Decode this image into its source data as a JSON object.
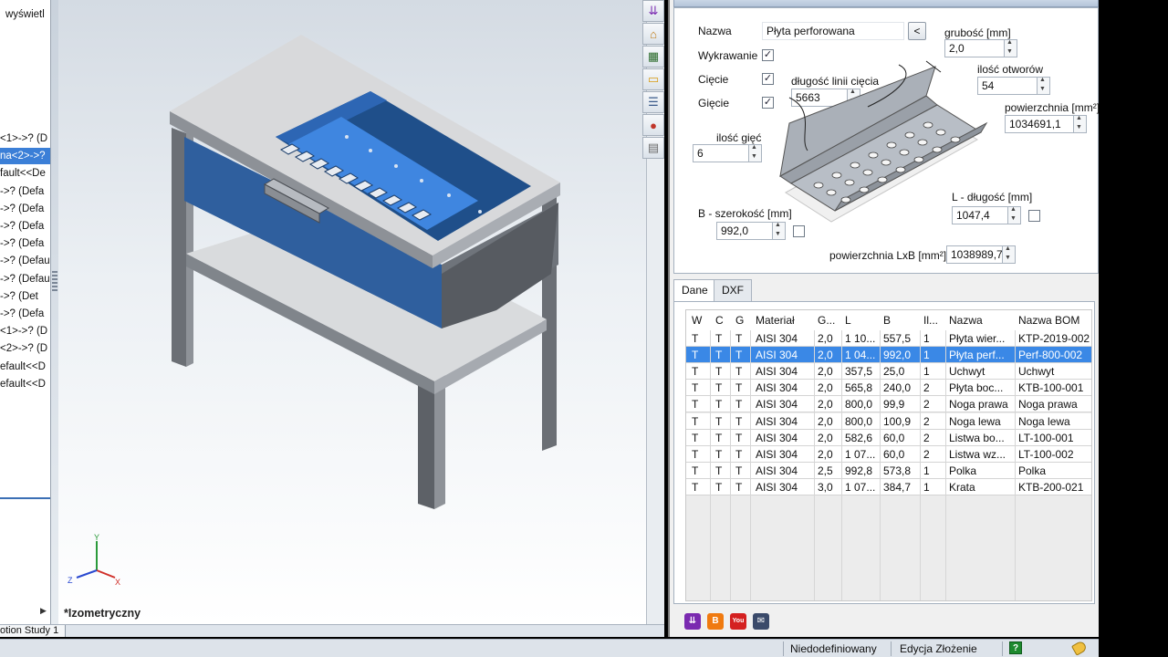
{
  "tree": {
    "title": "wyświetl",
    "items": [
      {
        "label": "<1>->? (D",
        "selected": false
      },
      {
        "label": "na<2>->?",
        "selected": true
      },
      {
        "label": "fault<<De",
        "selected": false
      },
      {
        "label": "->? (Defa",
        "selected": false
      },
      {
        "label": "->? (Defa",
        "selected": false
      },
      {
        "label": "->? (Defa",
        "selected": false
      },
      {
        "label": "->? (Defa",
        "selected": false
      },
      {
        "label": "->? (Defaul",
        "selected": false
      },
      {
        "label": "->? (Defaul",
        "selected": false
      },
      {
        "label": "->? (Det",
        "selected": false
      },
      {
        "label": "->? (Defa",
        "selected": false
      },
      {
        "label": "<1>->? (D",
        "selected": false
      },
      {
        "label": "<2>->? (D",
        "selected": false
      },
      {
        "label": "efault<<D",
        "selected": false
      },
      {
        "label": "efault<<D",
        "selected": false
      }
    ]
  },
  "viewport": {
    "view_name": "*Izometryczny",
    "triad": {
      "x": "X",
      "y": "Y",
      "z": "Z"
    }
  },
  "bottom_tab": {
    "label": "otion Study 1"
  },
  "status": {
    "state": "Niedodefiniowany",
    "mode": "Edycja Złożenie",
    "help": "?"
  },
  "side_icons": [
    {
      "name": "chevrons-down-icon",
      "glyph": "⇊",
      "color": "#7a2ab0"
    },
    {
      "name": "home-icon",
      "glyph": "⌂",
      "color": "#c07a10"
    },
    {
      "name": "parts-icon",
      "glyph": "▦",
      "color": "#2a6a2a"
    },
    {
      "name": "folder-icon",
      "glyph": "▭",
      "color": "#d89a10"
    },
    {
      "name": "list-icon",
      "glyph": "☰",
      "color": "#3a5a8a"
    },
    {
      "name": "appearance-icon",
      "glyph": "●",
      "color": "#c0352a"
    },
    {
      "name": "custom-props-icon",
      "glyph": "▤",
      "color": "#6a6a6a"
    }
  ],
  "form": {
    "name_label": "Nazwa",
    "name_value": "Płyta perforowana",
    "back_button": "<",
    "wykrawanie_label": "Wykrawanie",
    "wykrawanie_checked": true,
    "ciecie_label": "Cięcie",
    "ciecie_checked": true,
    "giecie_label": "Gięcie",
    "giecie_checked": true,
    "grubosc_label": "grubość [mm]",
    "grubosc_value": "2,0",
    "ilosc_otworow_label": "ilość otworów",
    "ilosc_otworow_value": "54",
    "dlugosc_linii_label": "długość linii cięcia",
    "dlugosc_linii_value": "5663",
    "powierzchnia_label": "powierzchnia [mm²]",
    "powierzchnia_value": "1034691,1",
    "ilosc_giec_label": "ilość gięć",
    "ilosc_giec_value": "6",
    "szerokosc_label": "B - szerokość [mm]",
    "szerokosc_value": "992,0",
    "dlugosc_label": "L - długość [mm]",
    "dlugosc_value": "1047,4",
    "powierzchnia_lxb_label": "powierzchnia LxB [mm²]",
    "powierzchnia_lxb_value": "1038989,7"
  },
  "tabs": [
    {
      "label": "Dane",
      "active": true
    },
    {
      "label": "DXF",
      "active": false
    }
  ],
  "table": {
    "columns": [
      "W",
      "C",
      "G",
      "Materiał",
      "G...",
      "L",
      "B",
      "Il...",
      "Nazwa",
      "Nazwa BOM"
    ],
    "rows": [
      {
        "selected": false,
        "cells": [
          "T",
          "T",
          "T",
          "AISI 304",
          "2,0",
          "1 10...",
          "557,5",
          "1",
          "Płyta wier...",
          "KTP-2019-002"
        ]
      },
      {
        "selected": true,
        "cells": [
          "T",
          "T",
          "T",
          "AISI 304",
          "2,0",
          "1 04...",
          "992,0",
          "1",
          "Płyta perf...",
          "Perf-800-002"
        ]
      },
      {
        "selected": false,
        "cells": [
          "T",
          "T",
          "T",
          "AISI 304",
          "2,0",
          "357,5",
          "25,0",
          "1",
          "Uchwyt",
          "Uchwyt"
        ]
      },
      {
        "selected": false,
        "cells": [
          "T",
          "T",
          "T",
          "AISI 304",
          "2,0",
          "565,8",
          "240,0",
          "2",
          "Płyta boc...",
          "KTB-100-001"
        ]
      },
      {
        "selected": false,
        "cells": [
          "T",
          "T",
          "T",
          "AISI 304",
          "2,0",
          "800,0",
          "99,9",
          "2",
          "Noga prawa",
          "Noga prawa"
        ]
      },
      {
        "selected": false,
        "cells": [
          "T",
          "T",
          "T",
          "AISI 304",
          "2,0",
          "800,0",
          "100,9",
          "2",
          "Noga lewa",
          "Noga lewa"
        ]
      },
      {
        "selected": false,
        "cells": [
          "T",
          "T",
          "T",
          "AISI 304",
          "2,0",
          "582,6",
          "60,0",
          "2",
          "Listwa bo...",
          "LT-100-001"
        ]
      },
      {
        "selected": false,
        "cells": [
          "T",
          "T",
          "T",
          "AISI 304",
          "2,0",
          "1 07...",
          "60,0",
          "2",
          "Listwa wz...",
          "LT-100-002"
        ]
      },
      {
        "selected": false,
        "cells": [
          "T",
          "T",
          "T",
          "AISI 304",
          "2,5",
          "992,8",
          "573,8",
          "1",
          "Polka",
          "Polka"
        ]
      },
      {
        "selected": false,
        "cells": [
          "T",
          "T",
          "T",
          "AISI 304",
          "3,0",
          "1 07...",
          "384,7",
          "1",
          "Krata",
          "KTB-200-021"
        ]
      }
    ]
  },
  "toolbar": [
    {
      "name": "chevrons-down-icon",
      "glyph": "⇊",
      "color": "#7a2ab0"
    },
    {
      "name": "blogger-icon",
      "glyph": "B",
      "color": "#f07a10"
    },
    {
      "name": "youtube-icon",
      "glyph": "You",
      "color": "#d42020"
    },
    {
      "name": "mail-icon",
      "glyph": "✉",
      "color": "#3a4a6a"
    }
  ]
}
